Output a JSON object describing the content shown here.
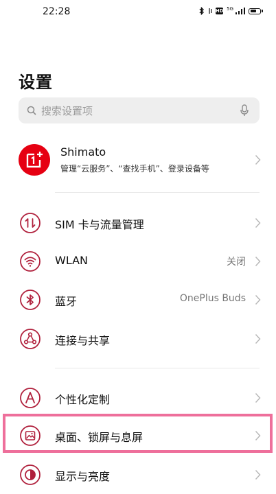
{
  "status_bar": {
    "time": "22:28",
    "network_label": "5G",
    "hd_label": "HD",
    "battery_level": 0.7
  },
  "page": {
    "title": "设置"
  },
  "search": {
    "placeholder": "搜索设置项"
  },
  "account": {
    "name": "Shimato",
    "subtitle": "管理“云服务”、“查找手机”、登录设备等",
    "avatar_color": "#e60012"
  },
  "menu": {
    "sim": {
      "label": "SIM 卡与流量管理",
      "icon": "sim-data-icon"
    },
    "wlan": {
      "label": "WLAN",
      "value": "关闭",
      "icon": "wifi-icon"
    },
    "bluetooth": {
      "label": "蓝牙",
      "value": "OnePlus Buds",
      "icon": "bluetooth-icon"
    },
    "connection": {
      "label": "连接与共享",
      "icon": "share-nodes-icon"
    },
    "personalize": {
      "label": "个性化定制",
      "icon": "personalize-icon"
    },
    "desktop": {
      "label": "桌面、锁屏与息屏",
      "icon": "wallpaper-icon"
    },
    "display": {
      "label": "显示与亮度",
      "icon": "brightness-icon"
    }
  },
  "accent_color": "#b0203c",
  "highlight_color": "#ee6f9b"
}
